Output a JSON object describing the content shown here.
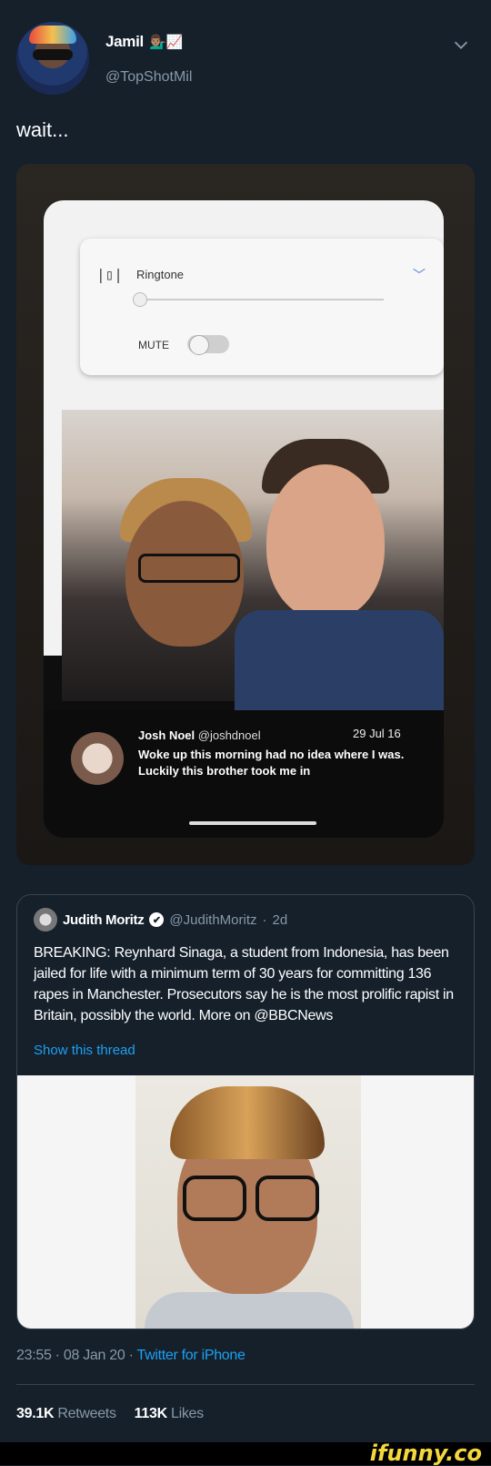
{
  "author": {
    "name": "Jamil",
    "emoji": "💁🏽‍♂️📈",
    "handle": "@TopShotMil"
  },
  "tweet_text": "wait...",
  "photo": {
    "volume_panel": {
      "title": "Ringtone",
      "mute_label": "MUTE"
    },
    "caption": {
      "author": "Josh Noel",
      "handle": "@joshdnoel",
      "date": "29 Jul 16",
      "text": "Woke up this morning had no idea where I was. Luckily this brother took me in"
    }
  },
  "quote": {
    "name": "Judith Moritz",
    "verified": "✔",
    "handle": "@JudithMoritz",
    "dot": "·",
    "time": "2d",
    "text": "BREAKING: Reynhard Sinaga, a student from Indonesia, has been jailed for life with a minimum term of 30 years for committing 136 rapes in Manchester. Prosecutors say he is the most prolific rapist in Britain, possibly the world. More on @BBCNews",
    "thread_link": "Show this thread"
  },
  "meta": {
    "time": "23:55 · 08 Jan 20 · ",
    "source": "Twitter for iPhone"
  },
  "stats": {
    "retweets_count": "39.1K",
    "retweets_label": "Retweets",
    "likes_count": "113K",
    "likes_label": "Likes"
  },
  "watermark": "ifunny.co",
  "colors": {
    "background": "#15202b",
    "link": "#1da1f2",
    "secondary": "#8899a6",
    "border": "#38444d"
  }
}
